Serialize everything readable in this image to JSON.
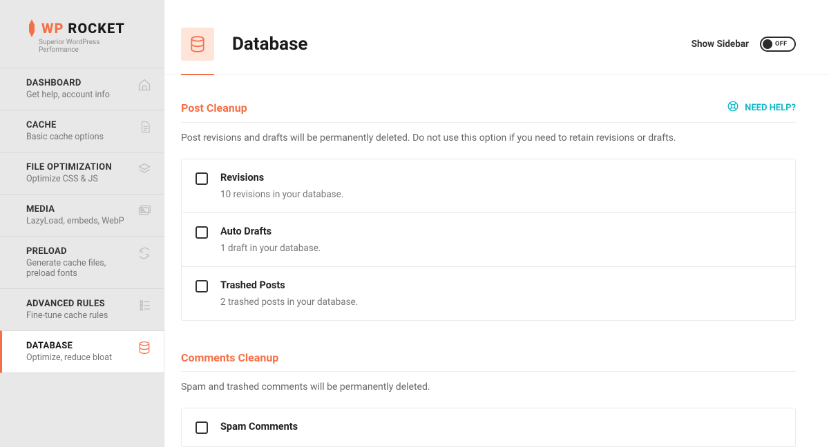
{
  "logo": {
    "wp": "WP",
    "rocket": "ROCKET",
    "tag": "Superior WordPress Performance"
  },
  "nav": {
    "dashboard": {
      "title": "DASHBOARD",
      "desc": "Get help, account info"
    },
    "cache": {
      "title": "CACHE",
      "desc": "Basic cache options"
    },
    "fileopt": {
      "title": "FILE OPTIMIZATION",
      "desc": "Optimize CSS & JS"
    },
    "media": {
      "title": "MEDIA",
      "desc": "LazyLoad, embeds, WebP"
    },
    "preload": {
      "title": "PRELOAD",
      "desc": "Generate cache files, preload fonts"
    },
    "advanced": {
      "title": "ADVANCED RULES",
      "desc": "Fine-tune cache rules"
    },
    "database": {
      "title": "DATABASE",
      "desc": "Optimize, reduce bloat"
    }
  },
  "header": {
    "title": "Database",
    "sidebar_label": "Show Sidebar",
    "toggle_off": "OFF"
  },
  "help": {
    "label": "NEED HELP?"
  },
  "post_cleanup": {
    "title": "Post Cleanup",
    "desc": "Post revisions and drafts will be permanently deleted. Do not use this option if you need to retain revisions or drafts.",
    "revisions": {
      "title": "Revisions",
      "desc": "10 revisions in your database."
    },
    "autodrafts": {
      "title": "Auto Drafts",
      "desc": "1 draft in your database."
    },
    "trashed": {
      "title": "Trashed Posts",
      "desc": "2 trashed posts in your database."
    }
  },
  "comments_cleanup": {
    "title": "Comments Cleanup",
    "desc": "Spam and trashed comments will be permanently deleted.",
    "spam": {
      "title": "Spam Comments"
    }
  }
}
